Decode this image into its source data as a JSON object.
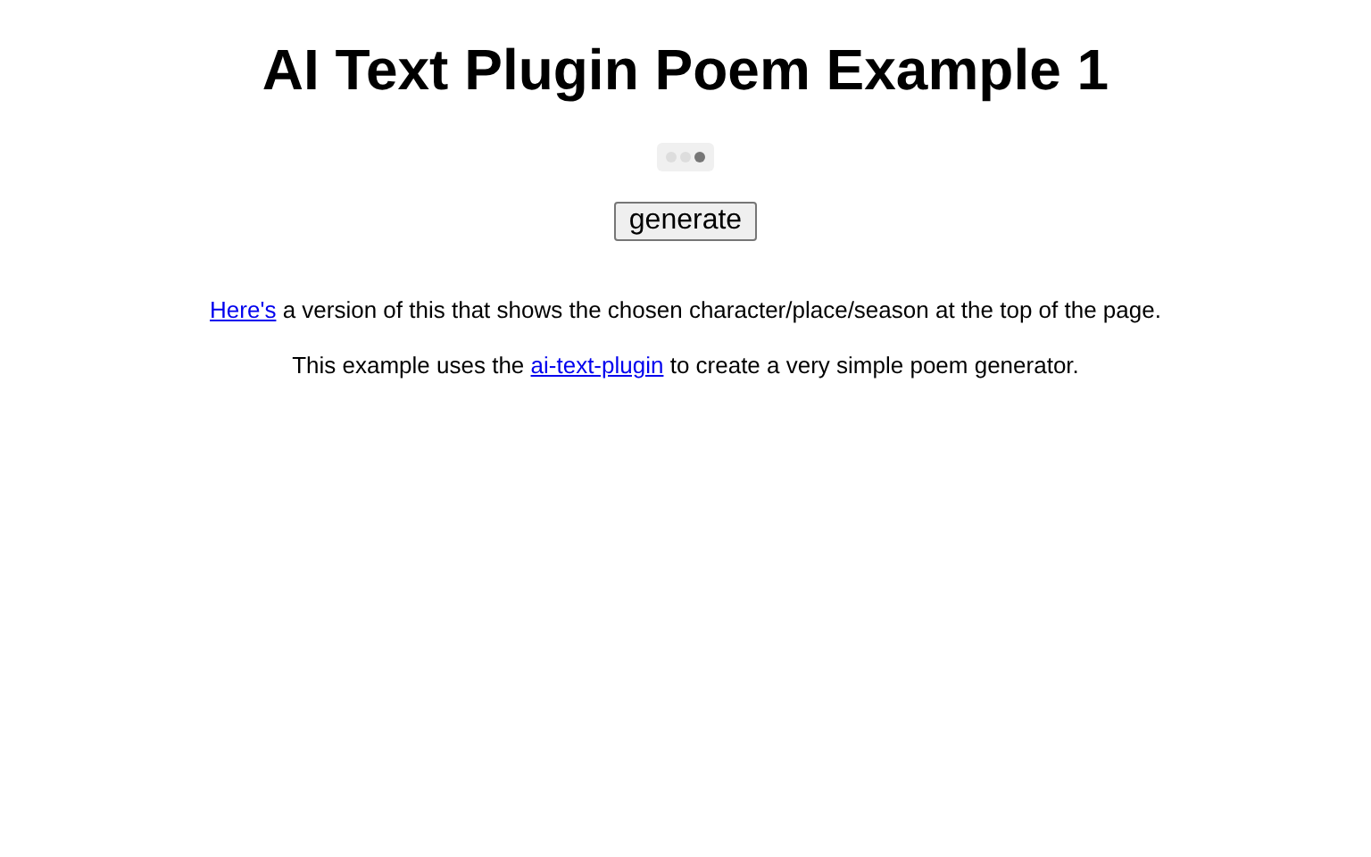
{
  "title": "AI Text Plugin Poem Example 1",
  "button": "generate",
  "notes": [
    {
      "parts": [
        {
          "kind": "link",
          "text": "Here's"
        },
        {
          "kind": "text",
          "text": " a version of this that shows the chosen character/place/season at the top of the page."
        }
      ]
    },
    {
      "parts": [
        {
          "kind": "text",
          "text": "This example uses the "
        },
        {
          "kind": "link",
          "text": "ai-text-plugin"
        },
        {
          "kind": "text",
          "text": " to create a very simple poem generator."
        }
      ]
    }
  ]
}
